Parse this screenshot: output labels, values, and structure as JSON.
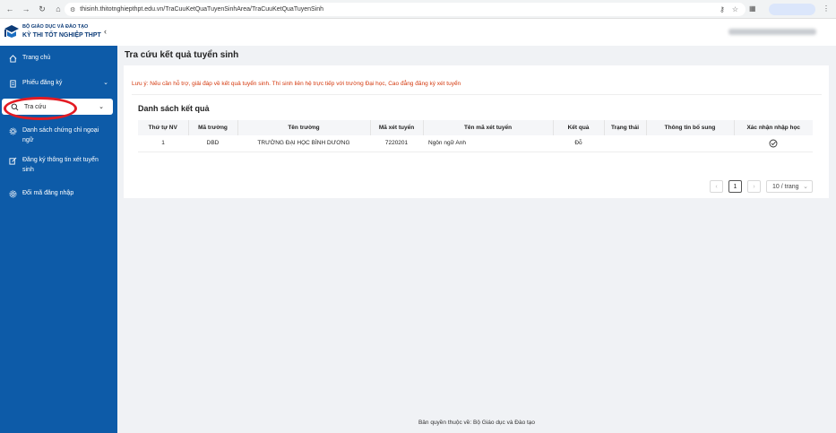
{
  "browser": {
    "url": "thisinh.thitotnghiepthpt.edu.vn/TraCuuKetQuaTuyenSinhArea/TraCuuKetQuaTuyenSinh"
  },
  "sidebar": {
    "logo_line1": "BỘ GIÁO DỤC VÀ ĐÀO TẠO",
    "logo_line2": "KỲ THI TỐT NGHIỆP THPT",
    "items": [
      {
        "label": "Trang chủ",
        "icon": "home-icon"
      },
      {
        "label": "Phiếu đăng ký",
        "icon": "document-icon"
      },
      {
        "label": "Tra cứu",
        "icon": "search-icon"
      },
      {
        "label": "Danh sách chứng chỉ ngoại ngữ",
        "icon": "gear-icon"
      },
      {
        "label": "Đăng ký thông tin xét tuyển sinh",
        "icon": "edit-icon"
      },
      {
        "label": "Đổi mã đăng nhập",
        "icon": "settings-icon"
      }
    ]
  },
  "page": {
    "title": "Tra cứu kết quả tuyển sinh",
    "note": "Lưu ý: Nếu cần hỗ trợ, giải đáp về kết quả tuyển sinh. Thí sinh liên hệ trực tiếp với trường Đại học, Cao đẳng đăng ký xét tuyển",
    "list_title": "Danh sách kết quả"
  },
  "table": {
    "headers": [
      "Thứ tự NV",
      "Mã trường",
      "Tên trường",
      "Mã xét tuyển",
      "Tên mã xét tuyển",
      "Kết quả",
      "Trạng thái",
      "Thông tin bổ sung",
      "Xác nhận nhập học"
    ],
    "rows": [
      {
        "order": "1",
        "school_code": "DBD",
        "school_name": "TRƯỜNG ĐẠI HỌC BÌNH DƯƠNG",
        "admission_code": "7220201",
        "admission_name": "Ngôn ngữ Anh",
        "result": "Đỗ",
        "status": "",
        "extra": "",
        "confirm_icon": "check-circle-icon"
      }
    ]
  },
  "pagination": {
    "current_page": "1",
    "page_size": "10 / trang",
    "prev": "‹",
    "next": "›"
  },
  "footer": {
    "text": "Bản quyền thuộc về: Bộ Giáo dục và Đào tạo"
  }
}
